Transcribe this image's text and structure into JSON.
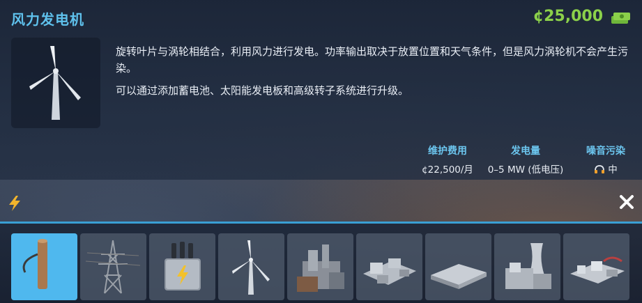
{
  "panel": {
    "title": "风力发电机",
    "price": "¢25,000",
    "description": [
      "旋转叶片与涡轮相结合，利用风力进行发电。功率输出取决于放置位置和天气条件，但是风力涡轮机不会产生污染。",
      "可以通过添加蓄电池、太阳能发电板和高级转子系统进行升级。"
    ],
    "stats": {
      "upkeep": {
        "label": "维护费用",
        "value": "¢22,500/月"
      },
      "power": {
        "label": "发电量",
        "value": "0–5 MW (低电压)"
      },
      "noise": {
        "label": "噪音污染",
        "value": "中"
      }
    }
  },
  "toolbar": {
    "category_icon": "lightning-icon",
    "close_icon": "close-icon"
  },
  "items": [
    {
      "name": "utility-pole",
      "selected": true
    },
    {
      "name": "transmission-tower",
      "selected": false
    },
    {
      "name": "transformer",
      "selected": false
    },
    {
      "name": "wind-turbine",
      "selected": false
    },
    {
      "name": "power-plant-large",
      "selected": false
    },
    {
      "name": "power-plant-complex",
      "selected": false
    },
    {
      "name": "solar-farm",
      "selected": false
    },
    {
      "name": "nuclear-plant",
      "selected": false
    },
    {
      "name": "industrial-plant",
      "selected": false
    }
  ],
  "colors": {
    "title": "#5fc1ec",
    "price": "#8bd04a",
    "accent": "#3a9fd4",
    "selected_slot": "#4fb8ee"
  }
}
